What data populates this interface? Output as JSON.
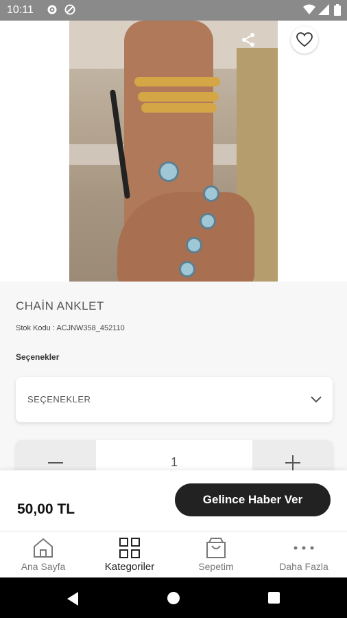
{
  "status_bar": {
    "time": "10:11"
  },
  "product": {
    "title": "CHAİN ANKLET",
    "stock_code": "Stok Kodu : ACJNW358_452110",
    "options_label": "Seçenekler",
    "options_value": "SEÇENEKLER",
    "quantity": "1",
    "price": "50,00 TL",
    "notify_button": "Gelince Haber Ver"
  },
  "tabs": [
    {
      "label": "Ana Sayfa",
      "icon": "home-icon"
    },
    {
      "label": "Kategoriler",
      "icon": "grid-icon"
    },
    {
      "label": "Sepetim",
      "icon": "cart-icon"
    },
    {
      "label": "Daha Fazla",
      "icon": "more-icon"
    }
  ],
  "colors": {
    "accent": "#222222",
    "status_bar": "#8a8a8a"
  }
}
